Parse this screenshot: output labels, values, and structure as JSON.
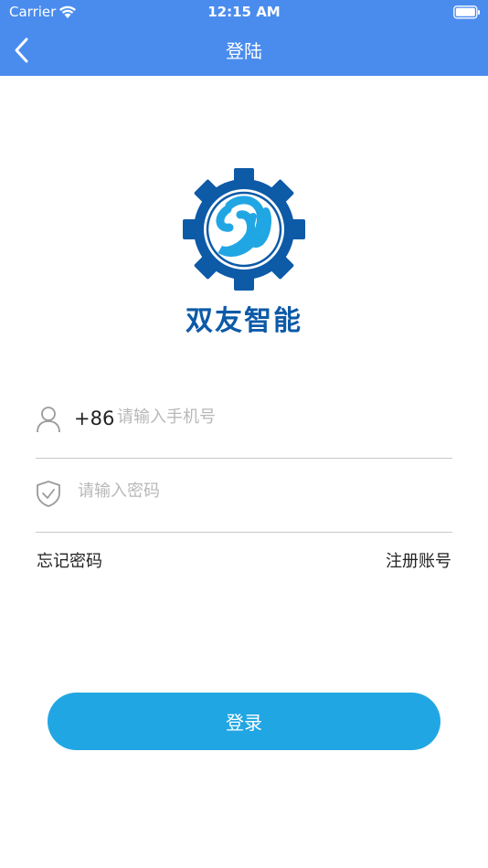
{
  "status_bar": {
    "carrier": "Carrier",
    "time": "12:15 AM"
  },
  "nav": {
    "title": "登陆"
  },
  "brand": {
    "name": "双友智能"
  },
  "phone": {
    "prefix": "+86",
    "placeholder": "请输入手机号",
    "value": ""
  },
  "password": {
    "placeholder": "请输入密码",
    "value": ""
  },
  "links": {
    "forgot": "忘记密码",
    "register": "注册账号"
  },
  "login_button": {
    "label": "登录"
  },
  "colors": {
    "nav_bg": "#4a8cee",
    "brand_blue": "#0d5aa7",
    "accent": "#21a6e4"
  }
}
